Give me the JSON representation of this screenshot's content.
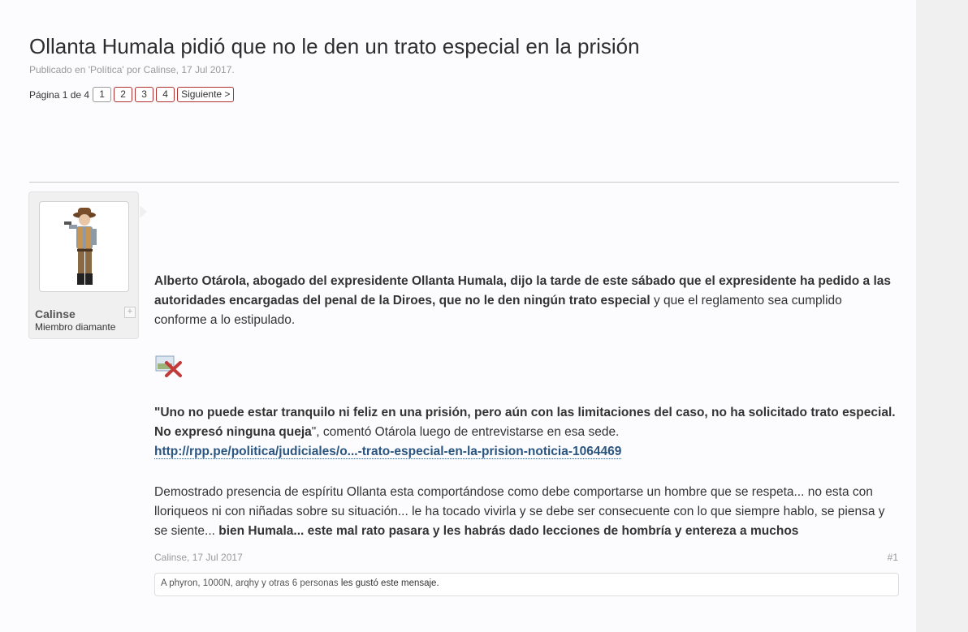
{
  "thread": {
    "title": "Ollanta Humala pidió que no le den un trato especial en la prisión",
    "byline": "Publicado en 'Política' por Calinse, 17 Jul 2017."
  },
  "pagination": {
    "label": "Página 1 de 4",
    "pages": [
      "1",
      "2",
      "3",
      "4"
    ],
    "current": "1",
    "next_label": "Siguiente >"
  },
  "post": {
    "author": {
      "name": "Calinse",
      "role": "Miembro diamante",
      "plus_icon": "+"
    },
    "p1_bold": "Alberto Otárola, abogado del expresidente Ollanta Humala, dijo la tarde de este sábado que el expresidente ha pedido a las autoridades encargadas del penal de la Diroes, que no le den ningún trato especial",
    "p1_rest": " y que el reglamento sea cumplido conforme a lo estipulado.",
    "image_icon": "broken-image-icon",
    "quote_bold": "\"Uno no puede estar tranquilo ni feliz en una prisión, pero aún con las limitaciones del caso, no ha solicitado trato especial. No expresó ninguna queja",
    "quote_rest": "\", comentó Otárola luego de entrevistarse en esa sede.",
    "link_text": "http://rpp.pe/politica/judiciales/o...-trato-especial-en-la-prision-noticia-1064469",
    "p3_normal": "Demostrado presencia de espíritu Ollanta esta comportándose como debe comportarse un hombre que se respeta... no esta con lloriqueos ni con niñadas sobre su situación... le ha tocado vivirla y se debe ser consecuente con lo que siempre hablo, se piensa y se siente... ",
    "p3_bold": "bien Humala... este mal rato pasara y les habrás dado lecciones de hombría y entereza a muchos",
    "meta": "Calinse, 17 Jul 2017",
    "number": "#1",
    "likes_names": "A phyron, 1000N, arqhy y otras 6 personas",
    "likes_suffix": " les gustó este mensaje."
  },
  "colors": {
    "accent_border": "#b03030",
    "link": "#2a5580"
  }
}
